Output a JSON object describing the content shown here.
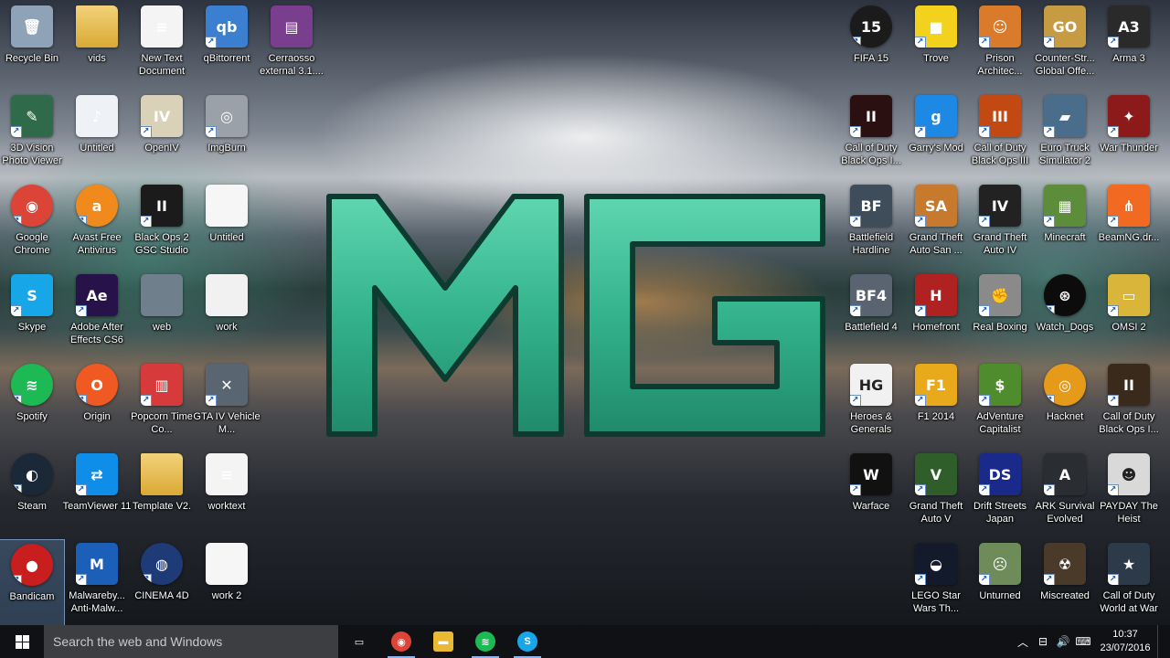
{
  "desktop": {
    "logo_text": "MG",
    "icons": [
      {
        "label": "Recycle Bin",
        "icon": "recycle-bin-icon",
        "col": 0,
        "row": 0,
        "bg": "#8fa3b8",
        "glyph": "🗑",
        "shortcut": false
      },
      {
        "label": "vids",
        "icon": "folder-icon",
        "col": 1,
        "row": 0,
        "bg": "#e8c15a",
        "glyph": "",
        "shortcut": false
      },
      {
        "label": "New Text Document",
        "icon": "text-document-icon",
        "col": 2,
        "row": 0,
        "bg": "#f4f4f4",
        "glyph": "≡",
        "shortcut": false
      },
      {
        "label": "qBittorrent",
        "icon": "qbittorrent-icon",
        "col": 3,
        "row": 0,
        "bg": "#3a7fd0",
        "glyph": "qb",
        "shortcut": true
      },
      {
        "label": "Cerraosso external 3.1....",
        "icon": "winrar-archive-icon",
        "col": 4,
        "row": 0,
        "bg": "#7a3e8e",
        "glyph": "▤",
        "shortcut": false
      },
      {
        "label": "3D Vision Photo Viewer",
        "icon": "3d-vision-icon",
        "col": 0,
        "row": 1,
        "bg": "#2f6b4a",
        "glyph": "✎",
        "shortcut": true
      },
      {
        "label": "Untitled",
        "icon": "mp3-file-icon",
        "col": 1,
        "row": 1,
        "bg": "#eef1f6",
        "glyph": "♪",
        "shortcut": false
      },
      {
        "label": "OpenIV",
        "icon": "openiv-icon",
        "col": 2,
        "row": 1,
        "bg": "#d9d2b8",
        "glyph": "IV",
        "shortcut": true
      },
      {
        "label": "ImgBurn",
        "icon": "imgburn-icon",
        "col": 3,
        "row": 1,
        "bg": "#9aa1a8",
        "glyph": "◎",
        "shortcut": true
      },
      {
        "label": "Google Chrome",
        "icon": "chrome-icon",
        "col": 0,
        "row": 2,
        "bg": "#db4437",
        "glyph": "◉",
        "shortcut": true,
        "round": true
      },
      {
        "label": "Avast Free Antivirus",
        "icon": "avast-icon",
        "col": 1,
        "row": 2,
        "bg": "#f08a1c",
        "glyph": "a",
        "shortcut": true,
        "round": true
      },
      {
        "label": "Black Ops 2 GSC Studio",
        "icon": "black-ops-2-gsc-icon",
        "col": 2,
        "row": 2,
        "bg": "#1b1b1b",
        "glyph": "II",
        "shortcut": true
      },
      {
        "label": "Untitled",
        "icon": "image-file-icon",
        "col": 3,
        "row": 2,
        "bg": "#f6f6f6",
        "glyph": "",
        "shortcut": false
      },
      {
        "label": "Skype",
        "icon": "skype-icon",
        "col": 0,
        "row": 3,
        "bg": "#17a6e8",
        "glyph": "S",
        "shortcut": true
      },
      {
        "label": "Adobe After Effects CS6",
        "icon": "after-effects-icon",
        "col": 1,
        "row": 3,
        "bg": "#27124a",
        "glyph": "Ae",
        "shortcut": true
      },
      {
        "label": "web",
        "icon": "battlefield-image-icon",
        "col": 2,
        "row": 3,
        "bg": "#6f7f8c",
        "glyph": "",
        "shortcut": false
      },
      {
        "label": "work",
        "icon": "image-file-icon",
        "col": 3,
        "row": 3,
        "bg": "#f1f1f1",
        "glyph": "",
        "shortcut": false
      },
      {
        "label": "Spotify",
        "icon": "spotify-icon",
        "col": 0,
        "row": 4,
        "bg": "#1db954",
        "glyph": "≋",
        "shortcut": true,
        "round": true
      },
      {
        "label": "Origin",
        "icon": "origin-icon",
        "col": 1,
        "row": 4,
        "bg": "#f05a22",
        "glyph": "O",
        "shortcut": true,
        "round": true
      },
      {
        "label": "Popcorn Time Co...",
        "icon": "popcorn-time-icon",
        "col": 2,
        "row": 4,
        "bg": "#d63a3a",
        "glyph": "▥",
        "shortcut": true
      },
      {
        "label": "GTA IV Vehicle M...",
        "icon": "gta-iv-vehicle-icon",
        "col": 3,
        "row": 4,
        "bg": "#5a6572",
        "glyph": "✕",
        "shortcut": true
      },
      {
        "label": "Steam",
        "icon": "steam-icon",
        "col": 0,
        "row": 5,
        "bg": "#1b2838",
        "glyph": "◐",
        "shortcut": true,
        "round": true
      },
      {
        "label": "TeamViewer 11",
        "icon": "teamviewer-icon",
        "col": 1,
        "row": 5,
        "bg": "#0e8ee9",
        "glyph": "⇄",
        "shortcut": true
      },
      {
        "label": "Template V2.",
        "icon": "folder-icon",
        "col": 2,
        "row": 5,
        "bg": "#e8c15a",
        "glyph": "",
        "shortcut": false
      },
      {
        "label": "worktext",
        "icon": "text-document-icon",
        "col": 3,
        "row": 5,
        "bg": "#f4f4f4",
        "glyph": "≡",
        "shortcut": false
      },
      {
        "label": "Bandicam",
        "icon": "bandicam-icon",
        "col": 0,
        "row": 6,
        "bg": "#c81e1e",
        "glyph": "●",
        "shortcut": true,
        "selected": true,
        "round": true
      },
      {
        "label": "Malwareby... Anti-Malw...",
        "icon": "malwarebytes-icon",
        "col": 1,
        "row": 6,
        "bg": "#1c5fb8",
        "glyph": "M",
        "shortcut": true
      },
      {
        "label": "CINEMA 4D",
        "icon": "cinema-4d-icon",
        "col": 2,
        "row": 6,
        "bg": "#1e3b78",
        "glyph": "◍",
        "shortcut": true,
        "round": true
      },
      {
        "label": "work 2",
        "icon": "image-file-icon",
        "col": 3,
        "row": 6,
        "bg": "#f6f6f6",
        "glyph": "",
        "shortcut": false
      },
      {
        "label": "FIFA 15",
        "icon": "fifa-15-icon",
        "col": 13,
        "row": 0,
        "bg": "#1b1b1b",
        "glyph": "15",
        "shortcut": true,
        "round": true
      },
      {
        "label": "Trove",
        "icon": "trove-icon",
        "col": 14,
        "row": 0,
        "bg": "#f2d21c",
        "glyph": "■",
        "shortcut": true
      },
      {
        "label": "Prison Architec...",
        "icon": "prison-architect-icon",
        "col": 15,
        "row": 0,
        "bg": "#d97b2b",
        "glyph": "☺",
        "shortcut": true
      },
      {
        "label": "Counter-Str... Global Offe...",
        "icon": "csgo-icon",
        "col": 16,
        "row": 0,
        "bg": "#c69b42",
        "glyph": "GO",
        "shortcut": true
      },
      {
        "label": "Arma 3",
        "icon": "arma-3-icon",
        "col": 17,
        "row": 0,
        "bg": "#2a2a2a",
        "glyph": "A3",
        "shortcut": true
      },
      {
        "label": "Call of Duty Black Ops I...",
        "icon": "black-ops-icon",
        "col": 13,
        "row": 1,
        "bg": "#2a1010",
        "glyph": "II",
        "shortcut": true
      },
      {
        "label": "Garry's Mod",
        "icon": "garrys-mod-icon",
        "col": 14,
        "row": 1,
        "bg": "#1e88e5",
        "glyph": "g",
        "shortcut": true
      },
      {
        "label": "Call of Duty Black Ops III",
        "icon": "black-ops-3-icon",
        "col": 15,
        "row": 1,
        "bg": "#c24a12",
        "glyph": "III",
        "shortcut": true
      },
      {
        "label": "Euro Truck Simulator 2",
        "icon": "euro-truck-icon",
        "col": 16,
        "row": 1,
        "bg": "#4a6d8c",
        "glyph": "▰",
        "shortcut": true
      },
      {
        "label": "War Thunder",
        "icon": "war-thunder-icon",
        "col": 17,
        "row": 1,
        "bg": "#8c1a1a",
        "glyph": "✦",
        "shortcut": true
      },
      {
        "label": "Battlefield Hardline",
        "icon": "battlefield-hardline-icon",
        "col": 13,
        "row": 2,
        "bg": "#3f4c5a",
        "glyph": "BF",
        "shortcut": true
      },
      {
        "label": "Grand Theft Auto San ...",
        "icon": "gta-san-andreas-icon",
        "col": 14,
        "row": 2,
        "bg": "#c77a2e",
        "glyph": "SA",
        "shortcut": true
      },
      {
        "label": "Grand Theft Auto IV",
        "icon": "gta-iv-icon",
        "col": 15,
        "row": 2,
        "bg": "#222222",
        "glyph": "IV",
        "shortcut": true
      },
      {
        "label": "Minecraft",
        "icon": "minecraft-icon",
        "col": 16,
        "row": 2,
        "bg": "#5d8c3a",
        "glyph": "▦",
        "shortcut": true
      },
      {
        "label": "BeamNG.dr...",
        "icon": "beamng-icon",
        "col": 17,
        "row": 2,
        "bg": "#f26a21",
        "glyph": "⋔",
        "shortcut": true
      },
      {
        "label": "Battlefield 4",
        "icon": "battlefield-4-icon",
        "col": 13,
        "row": 3,
        "bg": "#5a6470",
        "glyph": "BF4",
        "shortcut": true
      },
      {
        "label": "Homefront",
        "icon": "homefront-icon",
        "col": 14,
        "row": 3,
        "bg": "#b02222",
        "glyph": "H",
        "shortcut": true
      },
      {
        "label": "Real Boxing",
        "icon": "real-boxing-icon",
        "col": 15,
        "row": 3,
        "bg": "#8a8a8a",
        "glyph": "✊",
        "shortcut": true
      },
      {
        "label": "Watch_Dogs",
        "icon": "watch-dogs-icon",
        "col": 16,
        "row": 3,
        "bg": "#0c0c0c",
        "glyph": "⊛",
        "shortcut": true,
        "round": true
      },
      {
        "label": "OMSI 2",
        "icon": "omsi-2-icon",
        "col": 17,
        "row": 3,
        "bg": "#d9b63a",
        "glyph": "▭",
        "shortcut": true
      },
      {
        "label": "Heroes & Generals",
        "icon": "heroes-generals-icon",
        "col": 13,
        "row": 4,
        "bg": "#f1f1f1",
        "glyph": "HG",
        "shortcut": true,
        "dark": true
      },
      {
        "label": "F1 2014",
        "icon": "f1-2014-icon",
        "col": 14,
        "row": 4,
        "bg": "#e8a91a",
        "glyph": "F1",
        "shortcut": true
      },
      {
        "label": "AdVenture Capitalist",
        "icon": "adventure-capitalist-icon",
        "col": 15,
        "row": 4,
        "bg": "#4e8c2e",
        "glyph": "$",
        "shortcut": true
      },
      {
        "label": "Hacknet",
        "icon": "hacknet-icon",
        "col": 16,
        "row": 4,
        "bg": "#e59a1a",
        "glyph": "◎",
        "shortcut": true,
        "round": true
      },
      {
        "label": "Call of Duty Black Ops I...",
        "icon": "black-ops-icon",
        "col": 17,
        "row": 4,
        "bg": "#3a2a1c",
        "glyph": "II",
        "shortcut": true
      },
      {
        "label": "Warface",
        "icon": "warface-icon",
        "col": 13,
        "row": 5,
        "bg": "#111111",
        "glyph": "W",
        "shortcut": true
      },
      {
        "label": "Grand Theft Auto V",
        "icon": "gta-v-icon",
        "col": 14,
        "row": 5,
        "bg": "#2f5e2a",
        "glyph": "V",
        "shortcut": true
      },
      {
        "label": "Drift Streets Japan",
        "icon": "drift-streets-icon",
        "col": 15,
        "row": 5,
        "bg": "#1a2a8a",
        "glyph": "DS",
        "shortcut": true
      },
      {
        "label": "ARK Survival Evolved",
        "icon": "ark-icon",
        "col": 16,
        "row": 5,
        "bg": "#2a2e33",
        "glyph": "A",
        "shortcut": true
      },
      {
        "label": "PAYDAY The Heist",
        "icon": "payday-icon",
        "col": 17,
        "row": 5,
        "bg": "#d9d9d9",
        "glyph": "☻",
        "shortcut": true,
        "dark": true
      },
      {
        "label": "LEGO Star Wars Th...",
        "icon": "lego-star-wars-icon",
        "col": 14,
        "row": 6,
        "bg": "#121a2c",
        "glyph": "◒",
        "shortcut": true
      },
      {
        "label": "Unturned",
        "icon": "unturned-icon",
        "col": 15,
        "row": 6,
        "bg": "#6d8c5a",
        "glyph": "☹",
        "shortcut": true
      },
      {
        "label": "Miscreated",
        "icon": "miscreated-icon",
        "col": 16,
        "row": 6,
        "bg": "#4a3a2a",
        "glyph": "☢",
        "shortcut": true
      },
      {
        "label": "Call of Duty World at War",
        "icon": "world-at-war-icon",
        "col": 17,
        "row": 6,
        "bg": "#2c3a4a",
        "glyph": "★",
        "shortcut": true
      }
    ]
  },
  "taskbar": {
    "search_placeholder": "Search the web and Windows",
    "pinned": [
      {
        "name": "task-view",
        "icon": "task-view-icon",
        "glyph": "▭",
        "bg": "transparent",
        "running": false
      },
      {
        "name": "chrome",
        "icon": "chrome-icon",
        "glyph": "◉",
        "bg": "#db4437",
        "running": true
      },
      {
        "name": "file-explorer",
        "icon": "folder-icon",
        "glyph": "▬",
        "bg": "#e8b931",
        "running": false
      },
      {
        "name": "spotify",
        "icon": "spotify-icon",
        "glyph": "≋",
        "bg": "#1db954",
        "running": true
      },
      {
        "name": "skype",
        "icon": "skype-icon",
        "glyph": "S",
        "bg": "#17a6e8",
        "running": true
      }
    ],
    "tray": {
      "icons": [
        "chevron-up-icon",
        "network-icon",
        "volume-icon",
        "keyboard-icon"
      ],
      "glyphs": [
        "︿",
        "⊟",
        "🔊",
        "⌨"
      ],
      "time": "10:37",
      "date": "23/07/2016"
    }
  }
}
